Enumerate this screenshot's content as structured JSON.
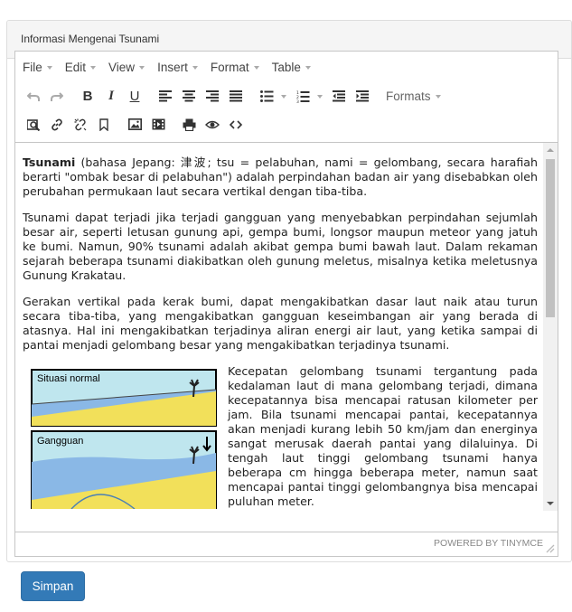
{
  "panel": {
    "title": "Informasi Mengenai Tsunami"
  },
  "menubar": [
    {
      "label": "File"
    },
    {
      "label": "Edit"
    },
    {
      "label": "View"
    },
    {
      "label": "Insert"
    },
    {
      "label": "Format"
    },
    {
      "label": "Table"
    }
  ],
  "toolbar": {
    "formats_label": "Formats"
  },
  "content": {
    "p1_bold": "Tsunami",
    "p1_rest": " (bahasa Jepang: 津波; tsu = pelabuhan, nami = gelombang, secara harafiah berarti \"ombak besar di pelabuhan\") adalah perpindahan badan air yang disebabkan oleh perubahan permukaan laut secara vertikal dengan tiba-tiba.",
    "p2": "Tsunami dapat terjadi jika terjadi gangguan yang menyebabkan perpindahan sejumlah besar air, seperti letusan gunung api, gempa bumi, longsor maupun meteor yang jatuh ke bumi. Namun, 90% tsunami adalah akibat gempa bumi bawah laut. Dalam rekaman sejarah beberapa tsunami diakibatkan oleh gunung meletus, misalnya ketika meletusnya Gunung Krakatau.",
    "p3": "Gerakan vertikal pada kerak bumi, dapat mengakibatkan dasar laut naik atau turun secara tiba-tiba, yang mengakibatkan gangguan keseimbangan air yang berada di atasnya. Hal ini mengakibatkan terjadinya aliran energi air laut, yang ketika sampai di pantai menjadi gelombang besar yang mengakibatkan terjadinya tsunami.",
    "p4": "Kecepatan gelombang tsunami tergantung pada kedalaman laut di mana gelombang terjadi, dimana kecepatannya bisa mencapai ratusan kilometer per jam. Bila tsunami mencapai pantai, kecepatannya akan menjadi kurang lebih 50 km/jam dan energinya sangat merusak daerah pantai yang dilaluinya. Di tengah laut tinggi gelombang tsunami hanya beberapa cm hingga beberapa meter, namun saat mencapai pantai tinggi gelombangnya bisa mencapai puluhan meter.",
    "figure_label_1": "Situasi normal",
    "figure_label_2": "Gangguan"
  },
  "statusbar": {
    "powered_by": "POWERED BY TINYMCE"
  },
  "actions": {
    "save_label": "Simpan"
  },
  "colors": {
    "primary": "#337ab7",
    "panel_heading_bg": "#f5f5f5",
    "border": "#dddddd"
  }
}
